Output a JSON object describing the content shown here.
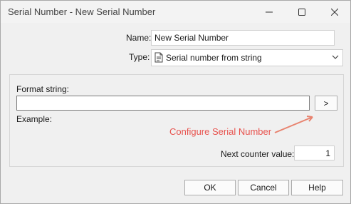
{
  "window": {
    "title": "Serial Number - New Serial Number"
  },
  "form": {
    "name_label": "Name:",
    "name_value": "New Serial Number",
    "type_label": "Type:",
    "type_value": "Serial number from string",
    "type_icon": "document-icon",
    "format_label": "Format string:",
    "format_value": "",
    "arrow_button_label": ">",
    "example_label": "Example:",
    "example_value": "",
    "counter_label": "Next counter value:",
    "counter_value": "1"
  },
  "annotation": {
    "text": "Configure Serial Number",
    "color": "#e8544f"
  },
  "buttons": {
    "ok": "OK",
    "cancel": "Cancel",
    "help": "Help"
  }
}
